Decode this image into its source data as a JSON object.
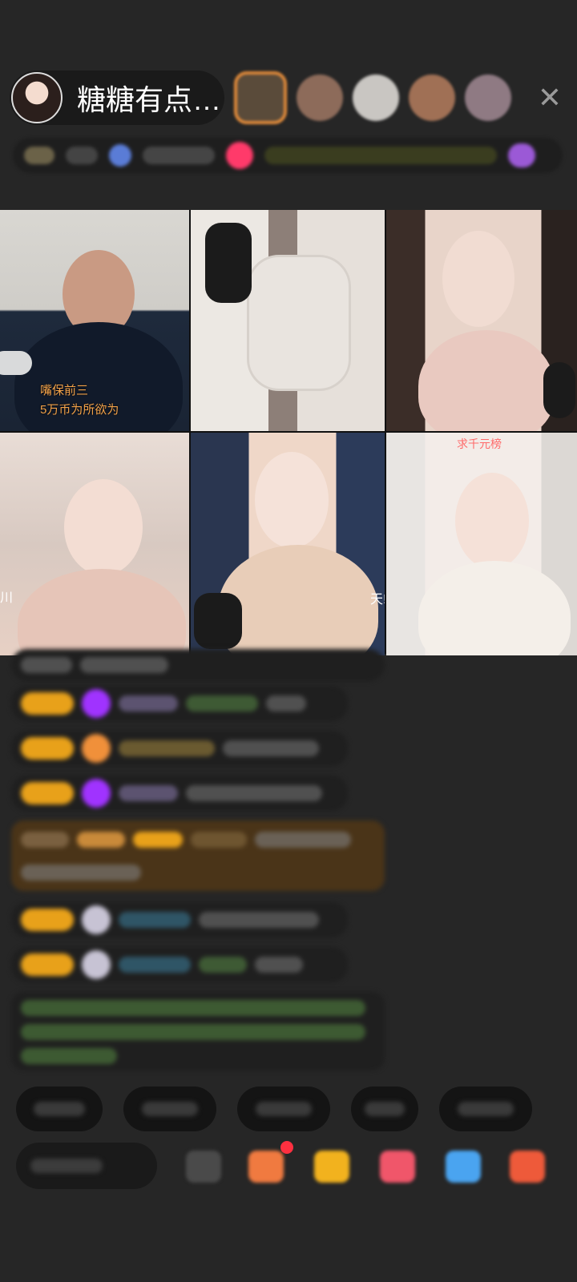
{
  "host": {
    "name": "糖糖有点…"
  },
  "header": {
    "close_icon": "close-icon",
    "viewer_count": 5
  },
  "video_grid": {
    "tile1_label": "嘴保前三\n5万币为所欲为",
    "tile6_label": "求千元榜",
    "tile4_side_text": "川",
    "tile5_side_text": "天!"
  },
  "colors": {
    "badge": "#e8a11a",
    "gem_purple": "#a033ff",
    "gem_orange": "#f0903a",
    "chat_green": "#6fbf4a",
    "chat_teal": "#3fa7c0",
    "highlight_bg": "#4a3418"
  },
  "chat": {
    "messages_count": 8
  },
  "bottom": {
    "quick_buttons_count": 5
  }
}
